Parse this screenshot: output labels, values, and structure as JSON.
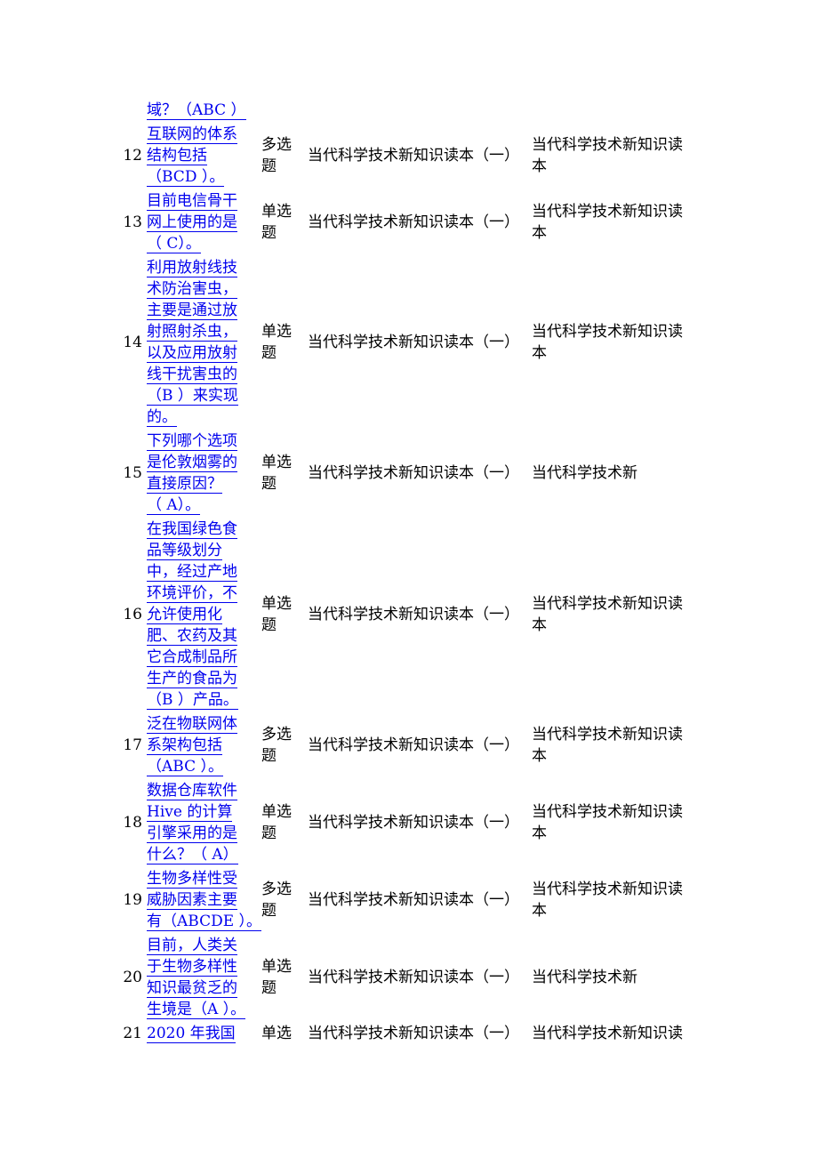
{
  "fragment": {
    "question_lines": [
      "域？（ABC ）"
    ]
  },
  "rows": [
    {
      "num": "12",
      "question_lines": [
        "互联网的体系",
        "结构包括",
        "（BCD ）。"
      ],
      "type_lines": [
        "多选",
        "题"
      ],
      "source": "当代科学技术新知识读本（一）",
      "book_lines": [
        "当代科学技术新知识读",
        "本"
      ]
    },
    {
      "num": "13",
      "question_lines": [
        "目前电信骨干",
        "网上使用的是",
        "（ C）。"
      ],
      "type_lines": [
        "单选",
        "题"
      ],
      "source": "当代科学技术新知识读本（一）",
      "book_lines": [
        "当代科学技术新知识读",
        "本"
      ]
    },
    {
      "num": "14",
      "question_lines": [
        "利用放射线技",
        "术防治害虫，",
        "主要是通过放",
        "射照射杀虫，",
        "以及应用放射",
        "线干扰害虫的",
        "（B ）来实现",
        "的。"
      ],
      "type_lines": [
        "单选",
        "题"
      ],
      "source": "当代科学技术新知识读本（一）",
      "book_lines": [
        "当代科学技术新知识读",
        "本"
      ]
    },
    {
      "num": "15",
      "question_lines": [
        "下列哪个选项",
        "是伦敦烟雾的",
        "直接原因？",
        "（ A）。"
      ],
      "type_lines": [
        "单选",
        "题"
      ],
      "source": "当代科学技术新知识读本（一）",
      "book_lines": [
        "当代科学技术新"
      ]
    },
    {
      "num": "16",
      "question_lines": [
        "在我国绿色食",
        "品等级划分",
        "中，经过产地",
        "环境评价，不",
        "允许使用化",
        "肥、农药及其",
        "它合成制品所",
        "生产的食品为",
        "（B ）产品。"
      ],
      "type_lines": [
        "单选",
        "题"
      ],
      "source": "当代科学技术新知识读本（一）",
      "book_lines": [
        "当代科学技术新知识读",
        "本"
      ]
    },
    {
      "num": "17",
      "question_lines": [
        "泛在物联网体",
        "系架构包括",
        "（ABC ）。"
      ],
      "type_lines": [
        "多选",
        "题"
      ],
      "source": "当代科学技术新知识读本（一）",
      "book_lines": [
        "当代科学技术新知识读",
        "本"
      ]
    },
    {
      "num": "18",
      "question_lines": [
        "数据仓库软件",
        "Hive 的计算",
        "引擎采用的是",
        "什么？（ A）"
      ],
      "type_lines": [
        "单选",
        "题"
      ],
      "source": "当代科学技术新知识读本（一）",
      "book_lines": [
        "当代科学技术新知识读",
        "本"
      ]
    },
    {
      "num": "19",
      "question_lines": [
        "生物多样性受",
        "威胁因素主要",
        "有（ABCDE ）。"
      ],
      "type_lines": [
        "多选",
        "题"
      ],
      "source": "当代科学技术新知识读本（一）",
      "book_lines": [
        "当代科学技术新知识读",
        "本"
      ]
    },
    {
      "num": "20",
      "question_lines": [
        "目前，人类关",
        "于生物多样性",
        "知识最贫乏的",
        "生境是（A ）。"
      ],
      "type_lines": [
        "单选",
        "题"
      ],
      "source": "当代科学技术新知识读本（一）",
      "book_lines": [
        "当代科学技术新"
      ]
    },
    {
      "num": "21",
      "question_lines": [
        "2020 年我国"
      ],
      "type_lines": [
        "单选"
      ],
      "source": "当代科学技术新知识读本（一）",
      "book_lines": [
        "当代科学技术新知识读"
      ]
    }
  ]
}
